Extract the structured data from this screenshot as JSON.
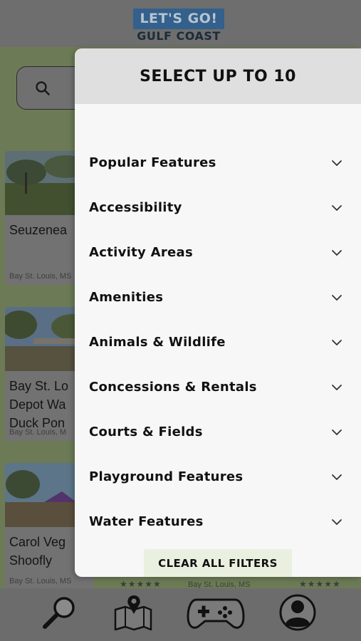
{
  "header": {
    "logo_top": "LET'S GO!",
    "logo_bottom": "GULF COAST"
  },
  "background": {
    "cards": [
      {
        "title": "Seuzenea",
        "location": "Bay St. Louis, MS"
      },
      {
        "title": "Bay St. Lo\nDepot Wa\nDuck Pon",
        "location": "Bay St. Louis, M"
      },
      {
        "title": "Carol Veg\nShoofly",
        "location": "Bay St. Louis, MS"
      }
    ],
    "peek_location": "Bay St. Louis, MS",
    "stars": "★★★★★"
  },
  "bottom_nav": [
    {
      "icon": "magnifier-icon"
    },
    {
      "icon": "map-icon"
    },
    {
      "icon": "gamepad-icon"
    },
    {
      "icon": "profile-icon"
    }
  ],
  "modal": {
    "title": "SELECT UP TO 10",
    "filters": [
      {
        "label": "Popular Features"
      },
      {
        "label": "Accessibility"
      },
      {
        "label": "Activity Areas"
      },
      {
        "label": "Amenities"
      },
      {
        "label": "Animals & Wildlife"
      },
      {
        "label": "Concessions & Rentals"
      },
      {
        "label": "Courts & Fields"
      },
      {
        "label": "Playground Features"
      },
      {
        "label": "Water Features"
      }
    ],
    "clear_label": "CLEAR ALL FILTERS"
  },
  "colors": {
    "modal_header": "#dfdfdf",
    "clear_button": "#eaf0df",
    "logo_blue": "#33608c"
  }
}
